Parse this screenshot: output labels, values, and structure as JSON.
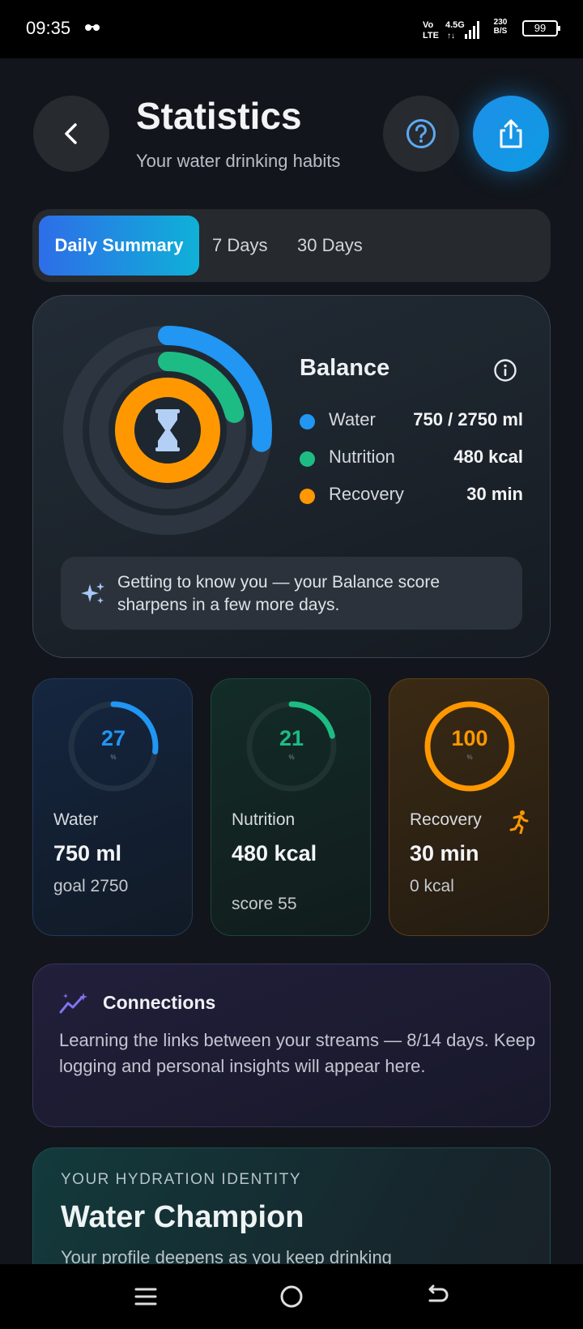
{
  "status_bar": {
    "time": "09:35",
    "speed_value": "230",
    "speed_unit": "B/S",
    "battery": "99"
  },
  "header": {
    "title": "Statistics",
    "subtitle": "Your water drinking habits"
  },
  "tabs": [
    {
      "label": "Daily Summary",
      "active": true
    },
    {
      "label": "7 Days",
      "active": false
    },
    {
      "label": "30 Days",
      "active": false
    }
  ],
  "balance": {
    "title": "Balance",
    "legend": [
      {
        "label": "Water",
        "value": "750 / 2750 ml",
        "color": "#2196f3"
      },
      {
        "label": "Nutrition",
        "value": "480 kcal",
        "color": "#1ebc85"
      },
      {
        "label": "Recovery",
        "value": "30 min",
        "color": "#ff9800"
      }
    ],
    "ring_levels": {
      "water": 0.27,
      "nutrition": 0.21,
      "recovery": 1.0
    },
    "hint": "Getting to know you — your Balance score sharpens in a few more days."
  },
  "metrics": [
    {
      "score": "27",
      "score_unit": "%",
      "label": "Water",
      "value": "750 ml",
      "sub": "goal 2750",
      "color": "#2196f3",
      "level": 0.27
    },
    {
      "score": "21",
      "score_unit": "%",
      "label": "Nutrition",
      "value": "480 kcal",
      "sub": "score 55",
      "color": "#1ebc85",
      "level": 0.21
    },
    {
      "score": "100",
      "score_unit": "%",
      "label": "Recovery",
      "value": "30 min",
      "sub": "0 kcal",
      "color": "#ff9800",
      "level": 1.0
    }
  ],
  "connections": {
    "title": "Connections",
    "text": "Learning the links between your streams — 8/14 days. Keep logging and personal insights will appear here."
  },
  "identity": {
    "eyebrow": "YOUR HYDRATION IDENTITY",
    "title": "Water Champion",
    "subtitle": "Your profile deepens as you keep drinking"
  }
}
